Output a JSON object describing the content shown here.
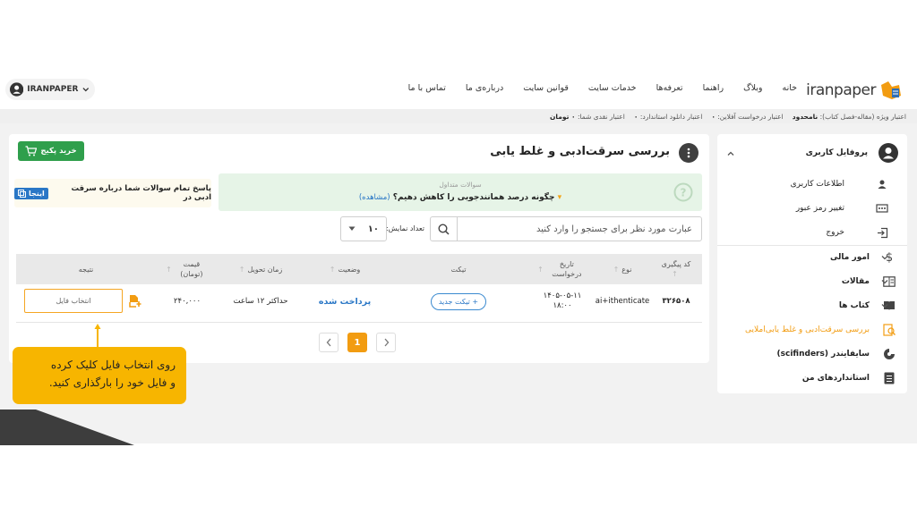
{
  "header": {
    "brand": "iranpaper",
    "menu": [
      "خانه",
      "وبلاگ",
      "راهنما",
      "تعرفه‌ها",
      "خدمات سایت",
      "قوانین سایت",
      "درباره‌ی ما",
      "تماس با ما"
    ],
    "account_label": "IRANPAPER"
  },
  "credit": {
    "special_label": "اعتبار ویژه (مقاله-فصل کتاب):",
    "special_value": "نامحدود",
    "online_label": "اعتبار درخواست آفلاین:",
    "online_value": "۰",
    "download_label": "اعتبار دانلود استاندارد:",
    "download_value": "۰",
    "cash_label": "اعتبار نقدی شما:",
    "cash_value": "۰ تومان"
  },
  "sidebar": {
    "profile": "پروفایل کاربری",
    "items": [
      {
        "label": "اطلاعات کاربری",
        "icon": "user-icon"
      },
      {
        "label": "تغییر رمز عبور",
        "icon": "password-icon"
      },
      {
        "label": "خروج",
        "icon": "logout-icon"
      },
      {
        "label": "امور مالی",
        "icon": "dollar-icon"
      },
      {
        "label": "مقالات",
        "icon": "article-icon"
      },
      {
        "label": "کتاب ها",
        "icon": "book-icon"
      },
      {
        "label": "بررسی سرقت‌ادبی و غلط یابی‌املایی",
        "icon": "plagiarism-icon"
      },
      {
        "label": "سایفایندر (scifinders)",
        "icon": "scifinder-icon"
      },
      {
        "label": "استانداردهای من",
        "icon": "standards-icon"
      }
    ],
    "active_color": "#f29c11"
  },
  "main": {
    "title": "بررسی سرقت‌ادبی و غلط یابی",
    "buy_label": "خرید پکیج",
    "faq_heading": "سوالات متداول",
    "faq_question": "چگونه درصد همانندجویی را کاهش دهیم؟",
    "faq_link": "(مشاهده)",
    "info_text": "پاسخ تمام سوالات شما درباره سرقت ادبی در",
    "info_link": "اینجا",
    "search_placeholder": "عبارت مورد نظر برای جستجو را وارد کنید",
    "count_label": "تعداد نمایش:",
    "count_value": "۱۰"
  },
  "table": {
    "headers": [
      "کد پیگیری",
      "نوع",
      "تاریخ درخواست",
      "تیکت",
      "وضعیت",
      "زمان تحویل",
      "قیمت (تومان)",
      "نتیجه"
    ],
    "row": {
      "code": "۳۲۶۵۰۸",
      "type": "ai+ithenticate",
      "date": "۱۴۰۵-۰۵-۱۱",
      "time": "۱۸:۰۰",
      "ticket": "+ تیکت جدید",
      "status": "پرداخت شده",
      "delivery": "حداکثر ۱۲ ساعت",
      "price": "۲۴۰,۰۰۰",
      "file": "انتخاب فایل"
    }
  },
  "pagination": {
    "current": "1"
  },
  "callout": {
    "line1": "روی انتخاب فایل کلیک کرده",
    "line2": "و فایل خود را بارگذاری کنید."
  },
  "colors": {
    "accent": "#f7b500",
    "green": "#2f9f4c",
    "blue": "#2a77c6"
  }
}
